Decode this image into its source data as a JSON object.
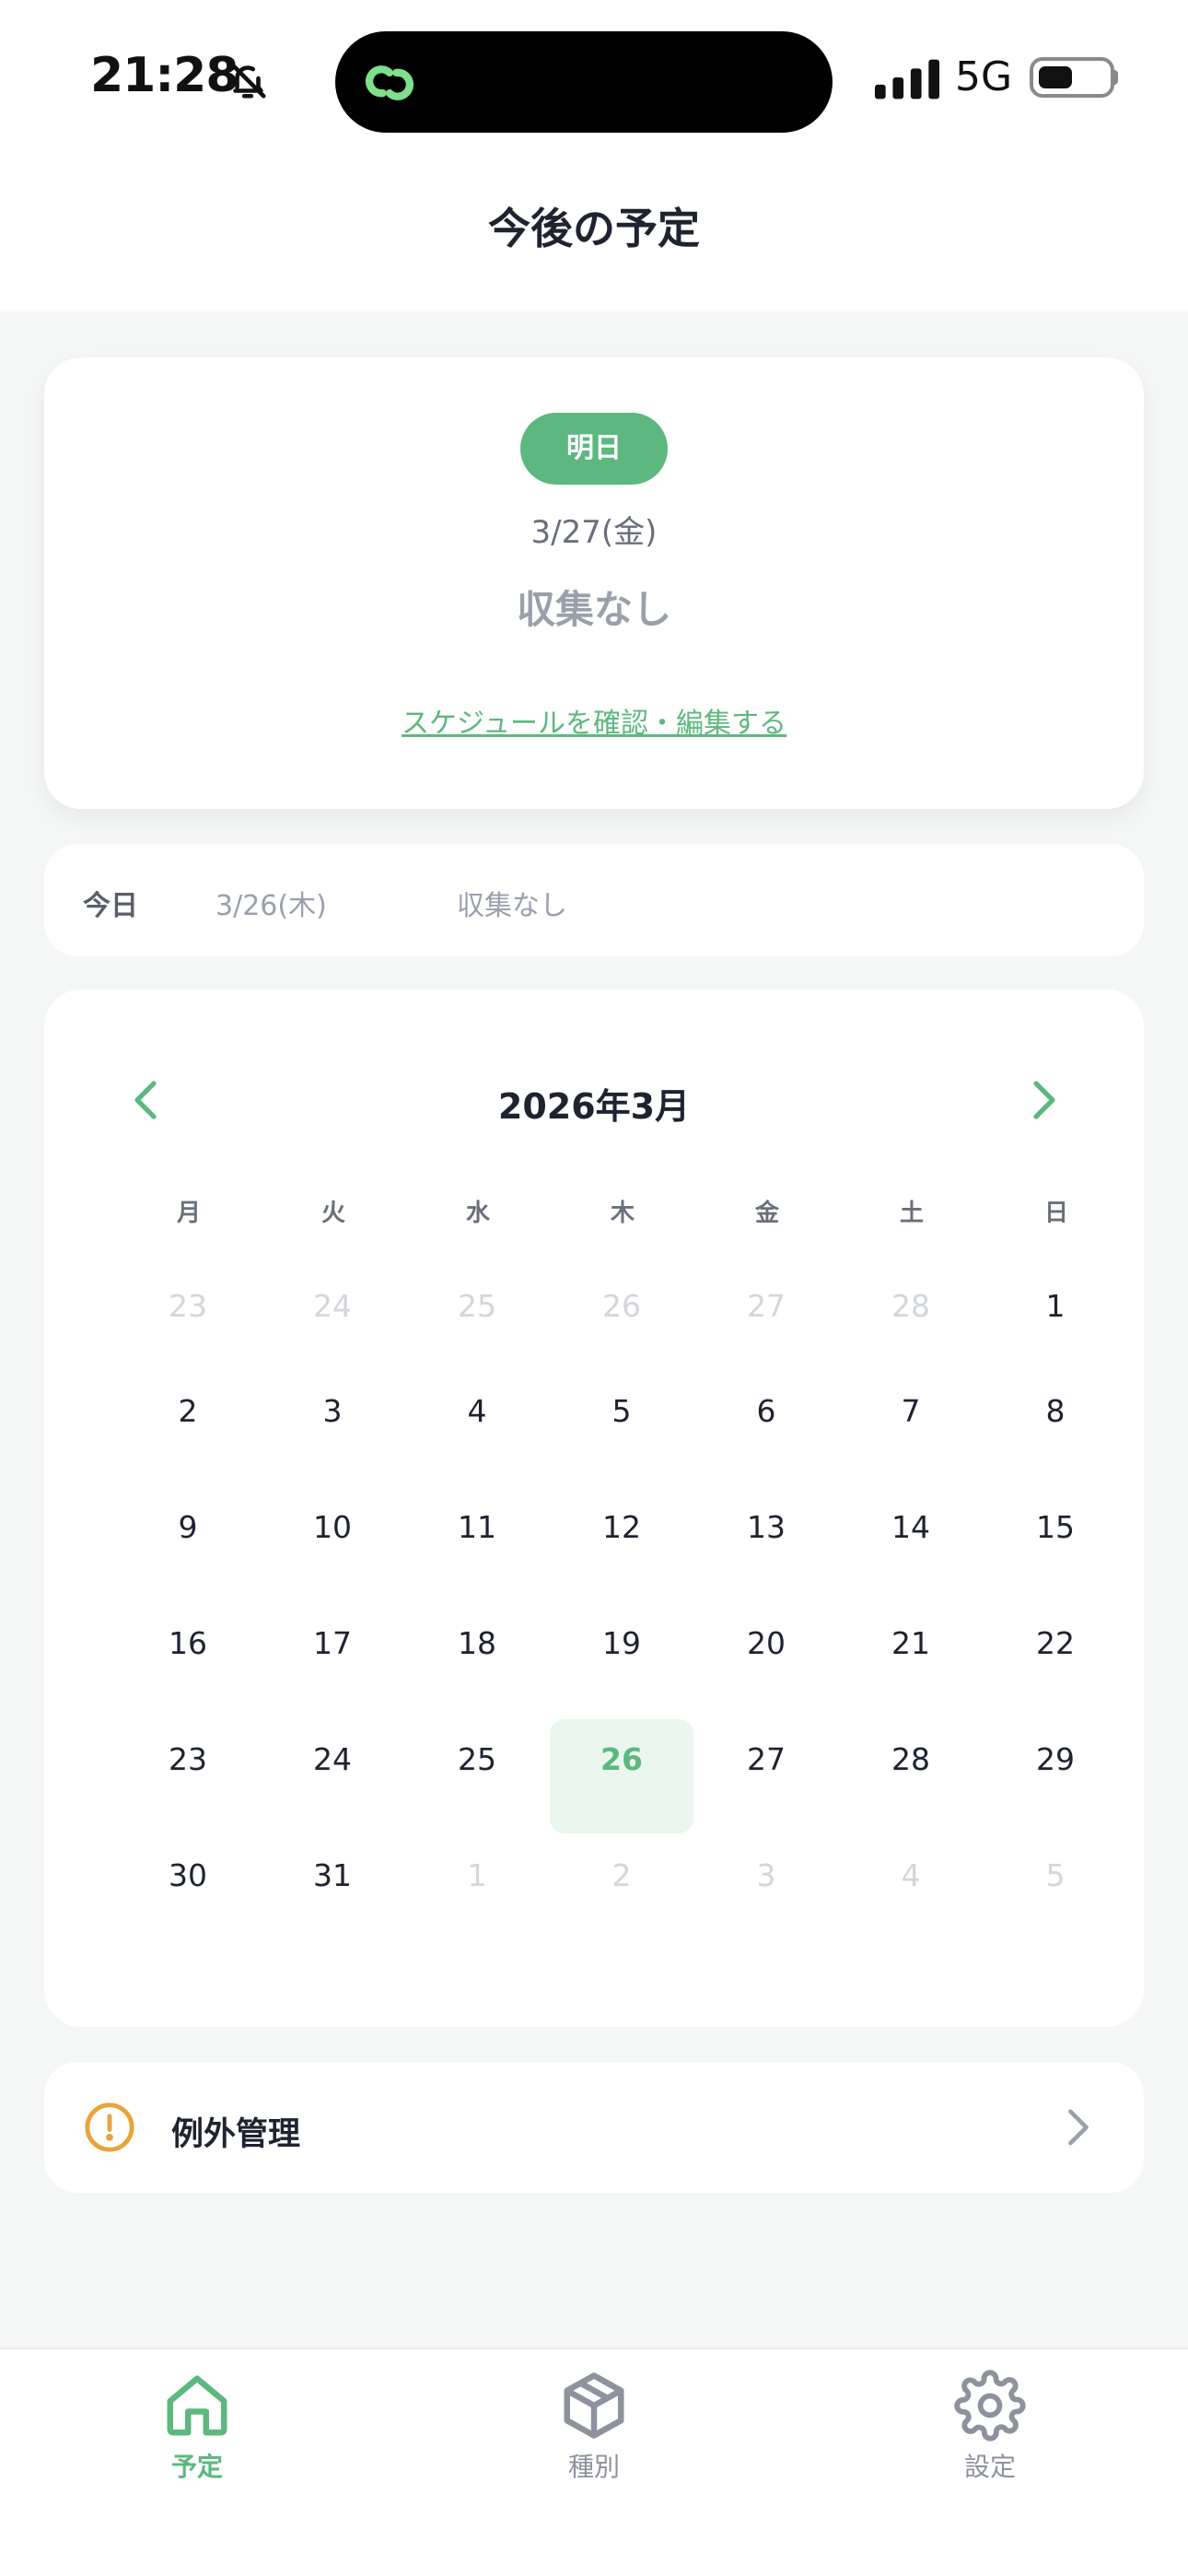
{
  "status_bar": {
    "time": "21:28",
    "network": "5G"
  },
  "header": {
    "title": "今後の予定"
  },
  "next_collection": {
    "badge": "明日",
    "date": "3/27(金)",
    "status": "収集なし",
    "edit_link": "スケジュールを確認・編集する"
  },
  "today": {
    "label": "今日",
    "date": "3/26(木)",
    "status": "収集なし"
  },
  "calendar": {
    "title": "2026年3月",
    "weekdays": [
      "月",
      "火",
      "水",
      "木",
      "金",
      "土",
      "日"
    ],
    "days": [
      {
        "d": "23",
        "m": true
      },
      {
        "d": "24",
        "m": true
      },
      {
        "d": "25",
        "m": true
      },
      {
        "d": "26",
        "m": true
      },
      {
        "d": "27",
        "m": true
      },
      {
        "d": "28",
        "m": true
      },
      {
        "d": "1"
      },
      {
        "d": "2"
      },
      {
        "d": "3"
      },
      {
        "d": "4"
      },
      {
        "d": "5"
      },
      {
        "d": "6"
      },
      {
        "d": "7"
      },
      {
        "d": "8"
      },
      {
        "d": "9"
      },
      {
        "d": "10"
      },
      {
        "d": "11"
      },
      {
        "d": "12"
      },
      {
        "d": "13"
      },
      {
        "d": "14"
      },
      {
        "d": "15"
      },
      {
        "d": "16"
      },
      {
        "d": "17"
      },
      {
        "d": "18"
      },
      {
        "d": "19"
      },
      {
        "d": "20"
      },
      {
        "d": "21"
      },
      {
        "d": "22"
      },
      {
        "d": "23"
      },
      {
        "d": "24"
      },
      {
        "d": "25"
      },
      {
        "d": "26",
        "today": true
      },
      {
        "d": "27"
      },
      {
        "d": "28"
      },
      {
        "d": "29"
      },
      {
        "d": "30"
      },
      {
        "d": "31"
      },
      {
        "d": "1",
        "m": true
      },
      {
        "d": "2",
        "m": true
      },
      {
        "d": "3",
        "m": true
      },
      {
        "d": "4",
        "m": true
      },
      {
        "d": "5",
        "m": true
      }
    ]
  },
  "exceptions": {
    "label": "例外管理"
  },
  "tabs": [
    {
      "label": "予定",
      "icon": "home-icon",
      "active": true
    },
    {
      "label": "種別",
      "icon": "box-icon",
      "active": false
    },
    {
      "label": "設定",
      "icon": "gear-icon",
      "active": false
    }
  ],
  "colors": {
    "accent": "#5cb87f",
    "warning": "#e8a33a",
    "today_bg": "#eaf7ee"
  }
}
